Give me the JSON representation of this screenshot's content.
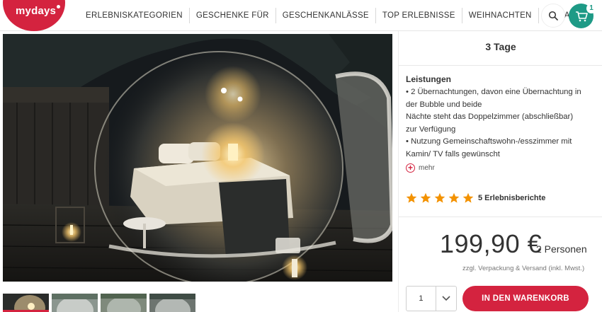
{
  "brand": {
    "logo_text": "mydays",
    "color": "#d4233f"
  },
  "nav": {
    "items": [
      {
        "label": "ERLEBNISKATEGORIEN"
      },
      {
        "label": "GESCHENKE FÜR"
      },
      {
        "label": "GESCHENKANLÄSSE"
      },
      {
        "label": "TOP ERLEBNISSE"
      },
      {
        "label": "WEIHNACHTEN"
      },
      {
        "label": "MAGAZIN"
      }
    ],
    "search_icon": "search-icon",
    "cart_icon": "cart-icon",
    "cart_count": "1",
    "cart_color": "#1e9a86"
  },
  "gallery": {
    "thumbnail_count": 4,
    "active_index": 0
  },
  "product": {
    "duration": "3 Tage",
    "services_heading": "Leistungen",
    "services_lines": [
      "• 2 Übernachtungen, davon eine Übernachtung in",
      "der Bubble und beide",
      "Nächte steht das Doppelzimmer (abschließbar)",
      "zur Verfügung",
      "• Nutzung Gemeinschaftswohn-/esszimmer mit",
      "Kamin/ TV falls gewünscht"
    ],
    "more_label": "mehr",
    "rating_stars": 5,
    "star_color": "#f39200",
    "reviews_label": "5 Erlebnisberichte",
    "price": "199,90 €",
    "persons": "2 Personen",
    "shipping_note": "zzgl. Verpackung & Versand (inkl. Mwst.)",
    "quantity": "1",
    "add_to_cart_label": "IN DEN WARENKORB"
  }
}
